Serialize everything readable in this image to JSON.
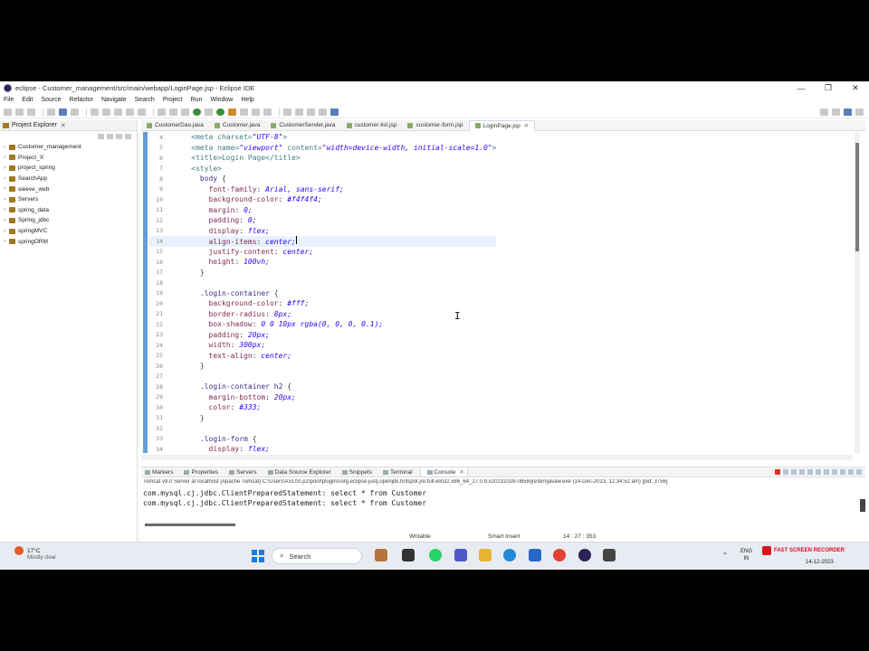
{
  "window": {
    "title": "eclipse - Customer_management/src/main/webapp/LoginPage.jsp - Eclipse IDE",
    "controls": [
      "—",
      "❐",
      "✕"
    ]
  },
  "menu": [
    "File",
    "Edit",
    "Source",
    "Refactor",
    "Navigate",
    "Search",
    "Project",
    "Run",
    "Window",
    "Help"
  ],
  "explorer": {
    "title": "Project Explorer",
    "close": "✕",
    "items": [
      "Customer_management",
      "Project_X",
      "project_spring",
      "SearchApp",
      "sieeve_web",
      "Servers",
      "spring_data",
      "Spring_jdbc",
      "springMVC",
      "springORM"
    ]
  },
  "editor_tabs": [
    {
      "label": "CustomerDao.java"
    },
    {
      "label": "Customer.java"
    },
    {
      "label": "CustomerServlet.java"
    },
    {
      "label": "customer-list.jsp"
    },
    {
      "label": "customer-form.jsp"
    },
    {
      "label": "LoginPage.jsp",
      "active": true
    }
  ],
  "code_lines": [
    {
      "n": "4",
      "text": "    <meta charset=\"UTF-8\">"
    },
    {
      "n": "5",
      "text": "    <meta name=\"viewport\" content=\"width=device-width, initial-scale=1.0\">"
    },
    {
      "n": "6",
      "text": "    <title>Login Page</title>"
    },
    {
      "n": "7",
      "text": "    <style>"
    },
    {
      "n": "8",
      "text": "      body {"
    },
    {
      "n": "9",
      "text": "        font-family: Arial, sans-serif;"
    },
    {
      "n": "10",
      "text": "        background-color: #f4f4f4;"
    },
    {
      "n": "11",
      "text": "        margin: 0;"
    },
    {
      "n": "12",
      "text": "        padding: 0;"
    },
    {
      "n": "13",
      "text": "        display: flex;"
    },
    {
      "n": "14",
      "text": "        align-items: center;",
      "current": true
    },
    {
      "n": "15",
      "text": "        justify-content: center;"
    },
    {
      "n": "16",
      "text": "        height: 100vh;"
    },
    {
      "n": "17",
      "text": "      }"
    },
    {
      "n": "18",
      "text": ""
    },
    {
      "n": "19",
      "text": "      .login-container {"
    },
    {
      "n": "20",
      "text": "        background-color: #fff;"
    },
    {
      "n": "21",
      "text": "        border-radius: 8px;"
    },
    {
      "n": "22",
      "text": "        box-shadow: 0 0 10px rgba(0, 0, 0, 0.1);"
    },
    {
      "n": "23",
      "text": "        padding: 20px;"
    },
    {
      "n": "24",
      "text": "        width: 300px;"
    },
    {
      "n": "25",
      "text": "        text-align: center;"
    },
    {
      "n": "26",
      "text": "      }"
    },
    {
      "n": "27",
      "text": ""
    },
    {
      "n": "28",
      "text": "      .login-container h2 {"
    },
    {
      "n": "29",
      "text": "        margin-bottom: 20px;"
    },
    {
      "n": "30",
      "text": "        color: #333;"
    },
    {
      "n": "31",
      "text": "      }"
    },
    {
      "n": "32",
      "text": ""
    },
    {
      "n": "33",
      "text": "      .login-form {"
    },
    {
      "n": "34",
      "text": "        display: flex;"
    }
  ],
  "console": {
    "tabs": [
      "Markers",
      "Properties",
      "Servers",
      "Data Source Explorer",
      "Snippets",
      "Terminal",
      "Console"
    ],
    "active_tab": "Console",
    "description": "Tomcat v9.0 Server at localhost [Apache Tomcat] C:\\Users\\ASUS\\.p2\\pool\\plugins\\org.eclipse.justj.openjdk.hotspot.jre.full.win32.x86_64_17.0.9.v20231028-0858\\jre\\bin\\javaw.exe (14-Dec-2023, 12:34:52 am) [pid: 3756]",
    "lines": [
      "com.mysql.cj.jdbc.ClientPreparedStatement: select * from Customer",
      "com.mysql.cj.jdbc.ClientPreparedStatement: select * from Customer"
    ]
  },
  "status": {
    "writable": "Writable",
    "insert_mode": "Smart Insert",
    "position": "14 : 27 : 353"
  },
  "taskbar": {
    "weather_temp": "17°C",
    "weather_cond": "Mostly clear",
    "search_placeholder": "Search",
    "lang": "ENG",
    "region": "IN",
    "date": "14-12-2023",
    "watermark": "FAST SCREEN RECORDER"
  },
  "colors": {
    "selector": "#3f2a8a",
    "property": "#7f2a55",
    "value": "#2a00ff",
    "tag": "#3f7f7f",
    "current_line": "#e8f2fe",
    "accent": "#4a8bd6"
  }
}
